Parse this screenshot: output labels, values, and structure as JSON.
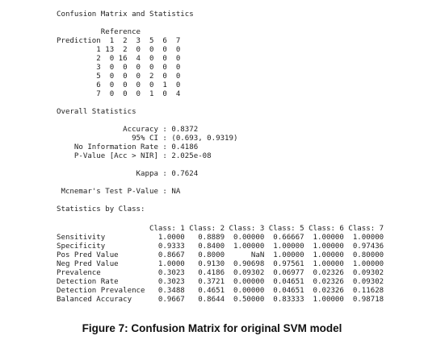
{
  "console": {
    "title": "Confusion Matrix and Statistics",
    "matrix_lines": [
      "          Reference",
      "Prediction  1  2  3  5  6  7",
      "         1 13  2  0  0  0  0",
      "         2  0 16  4  0  0  0",
      "         3  0  0  0  0  0  0",
      "         5  0  0  0  2  0  0",
      "         6  0  0  0  0  1  0",
      "         7  0  0  0  1  0  4"
    ],
    "overall_header": "Overall Statistics",
    "overall_lines": [
      "               Accuracy : 0.8372",
      "                 95% CI : (0.693, 0.9319)",
      "    No Information Rate : 0.4186",
      "    P-Value [Acc > NIR] : 2.025e-08"
    ],
    "kappa_line": "                  Kappa : 0.7624",
    "mcnemar_line": " Mcnemar's Test P-Value : NA",
    "by_class_header": "Statistics by Class:",
    "class_table_lines": [
      "                     Class: 1 Class: 2 Class: 3 Class: 5 Class: 6 Class: 7",
      "Sensitivity            1.0000   0.8889  0.00000  0.66667  1.00000  1.00000",
      "Specificity            0.9333   0.8400  1.00000  1.00000  1.00000  0.97436",
      "Pos Pred Value         0.8667   0.8000      NaN  1.00000  1.00000  0.80000",
      "Neg Pred Value         1.0000   0.9130  0.90698  0.97561  1.00000  1.00000",
      "Prevalence             0.3023   0.4186  0.09302  0.06977  0.02326  0.09302",
      "Detection Rate         0.3023   0.3721  0.00000  0.04651  0.02326  0.09302",
      "Detection Prevalence   0.3488   0.4651  0.00000  0.04651  0.02326  0.11628",
      "Balanced Accuracy      0.9667   0.8644  0.50000  0.83333  1.00000  0.98718"
    ]
  },
  "caption": "Figure 7: Confusion Matrix for original SVM model"
}
